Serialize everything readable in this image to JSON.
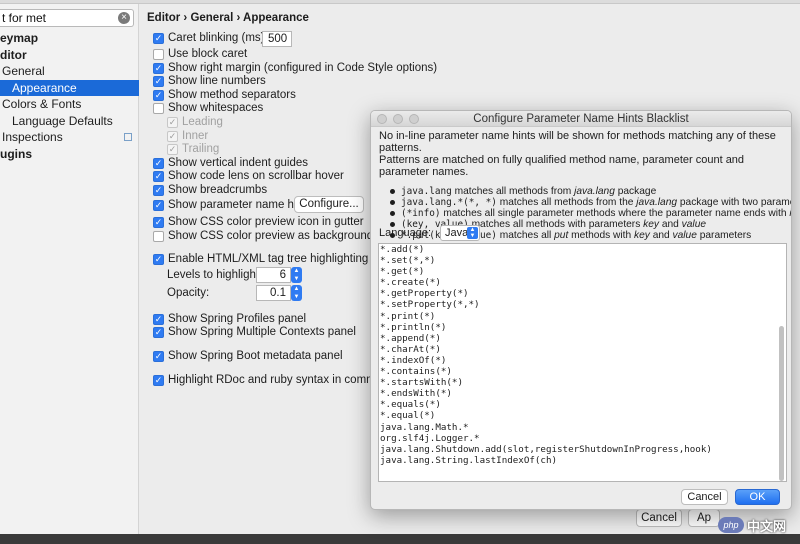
{
  "sidebar": {
    "search_value": "t for met",
    "tree": [
      {
        "label": "eymap",
        "bold": true
      },
      {
        "label": "ditor",
        "bold": true
      },
      {
        "label": "General",
        "indent": 2
      },
      {
        "label": "Appearance",
        "indent": 12,
        "selected": true
      },
      {
        "label": "Colors & Fonts",
        "indent": 2
      },
      {
        "label": "Language Defaults",
        "indent": 12
      },
      {
        "label": "Inspections",
        "indent": 2
      },
      {
        "label": "ugins",
        "bold": true
      }
    ]
  },
  "breadcrumb": "Editor › General › Appearance",
  "options": {
    "caret_blinking": {
      "label": "Caret blinking (ms):",
      "checked": true,
      "value": "500"
    },
    "block_caret": {
      "label": "Use block caret",
      "checked": false
    },
    "right_margin": {
      "label": "Show right margin (configured in Code Style options)",
      "checked": true
    },
    "line_numbers": {
      "label": "Show line numbers",
      "checked": true
    },
    "method_separators": {
      "label": "Show method separators",
      "checked": true
    },
    "whitespaces": {
      "label": "Show whitespaces",
      "checked": false
    },
    "leading": {
      "label": "Leading"
    },
    "inner": {
      "label": "Inner"
    },
    "trailing": {
      "label": "Trailing"
    },
    "indent_guides": {
      "label": "Show vertical indent guides",
      "checked": true
    },
    "code_lens": {
      "label": "Show code lens on scrollbar hover",
      "checked": true
    },
    "breadcrumbs": {
      "label": "Show breadcrumbs",
      "checked": true
    },
    "param_hints": {
      "label": "Show parameter name hints",
      "checked": true,
      "button": "Configure..."
    },
    "css_icon": {
      "label": "Show CSS color preview icon in gutter",
      "checked": true
    },
    "css_bg": {
      "label": "Show CSS color preview as background",
      "checked": false
    },
    "tag_tree": {
      "label": "Enable HTML/XML tag tree highlighting",
      "checked": true
    },
    "levels": {
      "label": "Levels to highlight:",
      "value": "6"
    },
    "opacity": {
      "label": "Opacity:",
      "value": "0.1"
    },
    "spring_profiles": {
      "label": "Show Spring Profiles panel",
      "checked": true
    },
    "spring_contexts": {
      "label": "Show Spring Multiple Contexts panel",
      "checked": true
    },
    "spring_boot": {
      "label": "Show Spring Boot metadata panel",
      "checked": true
    },
    "rdoc": {
      "label": "Highlight RDoc and ruby syntax in comments",
      "checked": true
    }
  },
  "bottom_buttons": {
    "cancel": "Cancel",
    "apply": "Ap"
  },
  "dialog": {
    "title": "Configure Parameter Name Hints Blacklist",
    "intro_line1": "No in-line parameter name hints will be shown for methods matching any of these patterns.",
    "intro_line2": "Patterns are matched on fully qualified method name, parameter count and parameter names.",
    "bullets": [
      {
        "code": "java.lang",
        "t1": " matches all methods from ",
        "i1": "java.lang",
        "t2": " package",
        "i2": "",
        "t3": "",
        "i3": "",
        "t4": ""
      },
      {
        "code": "java.lang.*(*, *)",
        "t1": " matches all methods from the ",
        "i1": "java.lang",
        "t2": " package with two parameters",
        "i2": "",
        "t3": "",
        "i3": "",
        "t4": ""
      },
      {
        "code": "(*info)",
        "t1": " matches all single parameter methods where the parameter name ends with ",
        "i1": "info",
        "t2": "",
        "i2": "",
        "t3": "",
        "i3": "",
        "t4": ""
      },
      {
        "code": "(key, value)",
        "t1": " matches all methods with parameters ",
        "i1": "key",
        "t2": " and ",
        "i2": "value",
        "t3": "",
        "i3": "",
        "t4": ""
      },
      {
        "code": "*.put(key, value)",
        "t1": " matches all ",
        "i1": "put",
        "t2": " methods with ",
        "i2": "key",
        "t3": " and ",
        "i3": "value",
        "t4": " parameters"
      }
    ],
    "language_label": "Language:",
    "language_value": "Java",
    "patterns": [
      "*.add(*)",
      "*.set(*,*)",
      "*.get(*)",
      "*.create(*)",
      "*.getProperty(*)",
      "*.setProperty(*,*)",
      "*.print(*)",
      "*.println(*)",
      "*.append(*)",
      "*.charAt(*)",
      "*.indexOf(*)",
      "*.contains(*)",
      "*.startsWith(*)",
      "*.endsWith(*)",
      "*.equals(*)",
      "*.equal(*)",
      "java.lang.Math.*",
      "org.slf4j.Logger.*",
      "java.lang.Shutdown.add(slot,registerShutdownInProgress,hook)",
      "java.lang.String.lastIndexOf(ch)"
    ],
    "cancel_label": "Cancel",
    "ok_label": "OK"
  },
  "watermark": {
    "logo": "php",
    "text": "中文网"
  }
}
